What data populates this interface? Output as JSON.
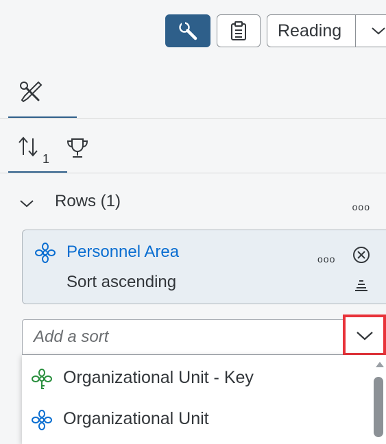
{
  "toolbar": {
    "reading_label": "Reading",
    "icons": [
      "wrench-icon",
      "clipboard-icon",
      "chevron-down-icon"
    ],
    "accent": "#2e5f8a"
  },
  "tabs": {
    "primary": "tools-icon",
    "secondary": [
      "sort-icon",
      "trophy-icon"
    ],
    "sort_badge": "1"
  },
  "rows": {
    "title": "Rows (1)",
    "more": "ooo"
  },
  "sort_card": {
    "title": "Personnel Area",
    "subtitle": "Sort ascending",
    "more": "ooo",
    "title_color": "#0a6ed1"
  },
  "add_sort": {
    "placeholder": "Add a sort"
  },
  "dropdown": {
    "highlight_color": "#e8333a",
    "items": [
      {
        "label": "Organizational Unit - Key",
        "icon": "hierarchy-key-icon"
      },
      {
        "label": "Organizational Unit",
        "icon": "hierarchy-icon"
      }
    ]
  }
}
